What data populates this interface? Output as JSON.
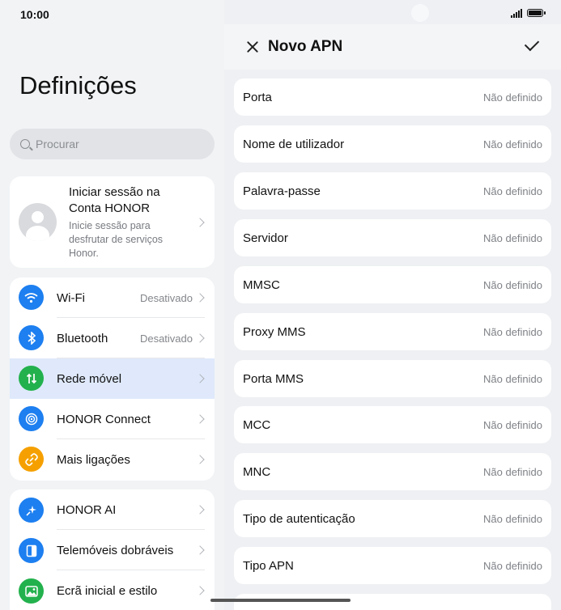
{
  "status": {
    "time": "10:00"
  },
  "left": {
    "title": "Definições",
    "search_placeholder": "Procurar",
    "account": {
      "title": "Iniciar sessão na Conta HONOR",
      "subtitle": "Inicie sessão para desfrutar de serviços Honor."
    },
    "group1": [
      {
        "label": "Wi-Fi",
        "value": "Desativado",
        "icon": "wifi-icon",
        "color": "#1d7ff0"
      },
      {
        "label": "Bluetooth",
        "value": "Desativado",
        "icon": "bluetooth-icon",
        "color": "#1d7ff0"
      },
      {
        "label": "Rede móvel",
        "value": "",
        "icon": "mobile-data-icon",
        "color": "#23b14d",
        "active": true
      },
      {
        "label": "HONOR Connect",
        "value": "",
        "icon": "honor-connect-icon",
        "color": "#1d7ff0"
      },
      {
        "label": "Mais ligações",
        "value": "",
        "icon": "link-icon",
        "color": "#f5a000"
      }
    ],
    "group2": [
      {
        "label": "HONOR AI",
        "icon": "ai-sparkle-icon",
        "color": "#1d7ff0"
      },
      {
        "label": "Telemóveis dobráveis",
        "icon": "foldable-phone-icon",
        "color": "#1d7ff0"
      },
      {
        "label": "Ecrã inicial e estilo",
        "icon": "image-icon",
        "color": "#23b14d"
      }
    ]
  },
  "right": {
    "header_title": "Novo APN",
    "items": [
      {
        "label": "Porta",
        "value": "Não definido"
      },
      {
        "label": "Nome de utilizador",
        "value": "Não definido"
      },
      {
        "label": "Palavra-passe",
        "value": "Não definido"
      },
      {
        "label": "Servidor",
        "value": "Não definido"
      },
      {
        "label": "MMSC",
        "value": "Não definido"
      },
      {
        "label": "Proxy MMS",
        "value": "Não definido"
      },
      {
        "label": "Porta MMS",
        "value": "Não definido"
      },
      {
        "label": "MCC",
        "value": "Não definido"
      },
      {
        "label": "MNC",
        "value": "Não definido"
      },
      {
        "label": "Tipo de autenticação",
        "value": "Não definido"
      },
      {
        "label": "Tipo APN",
        "value": "Não definido"
      }
    ]
  }
}
